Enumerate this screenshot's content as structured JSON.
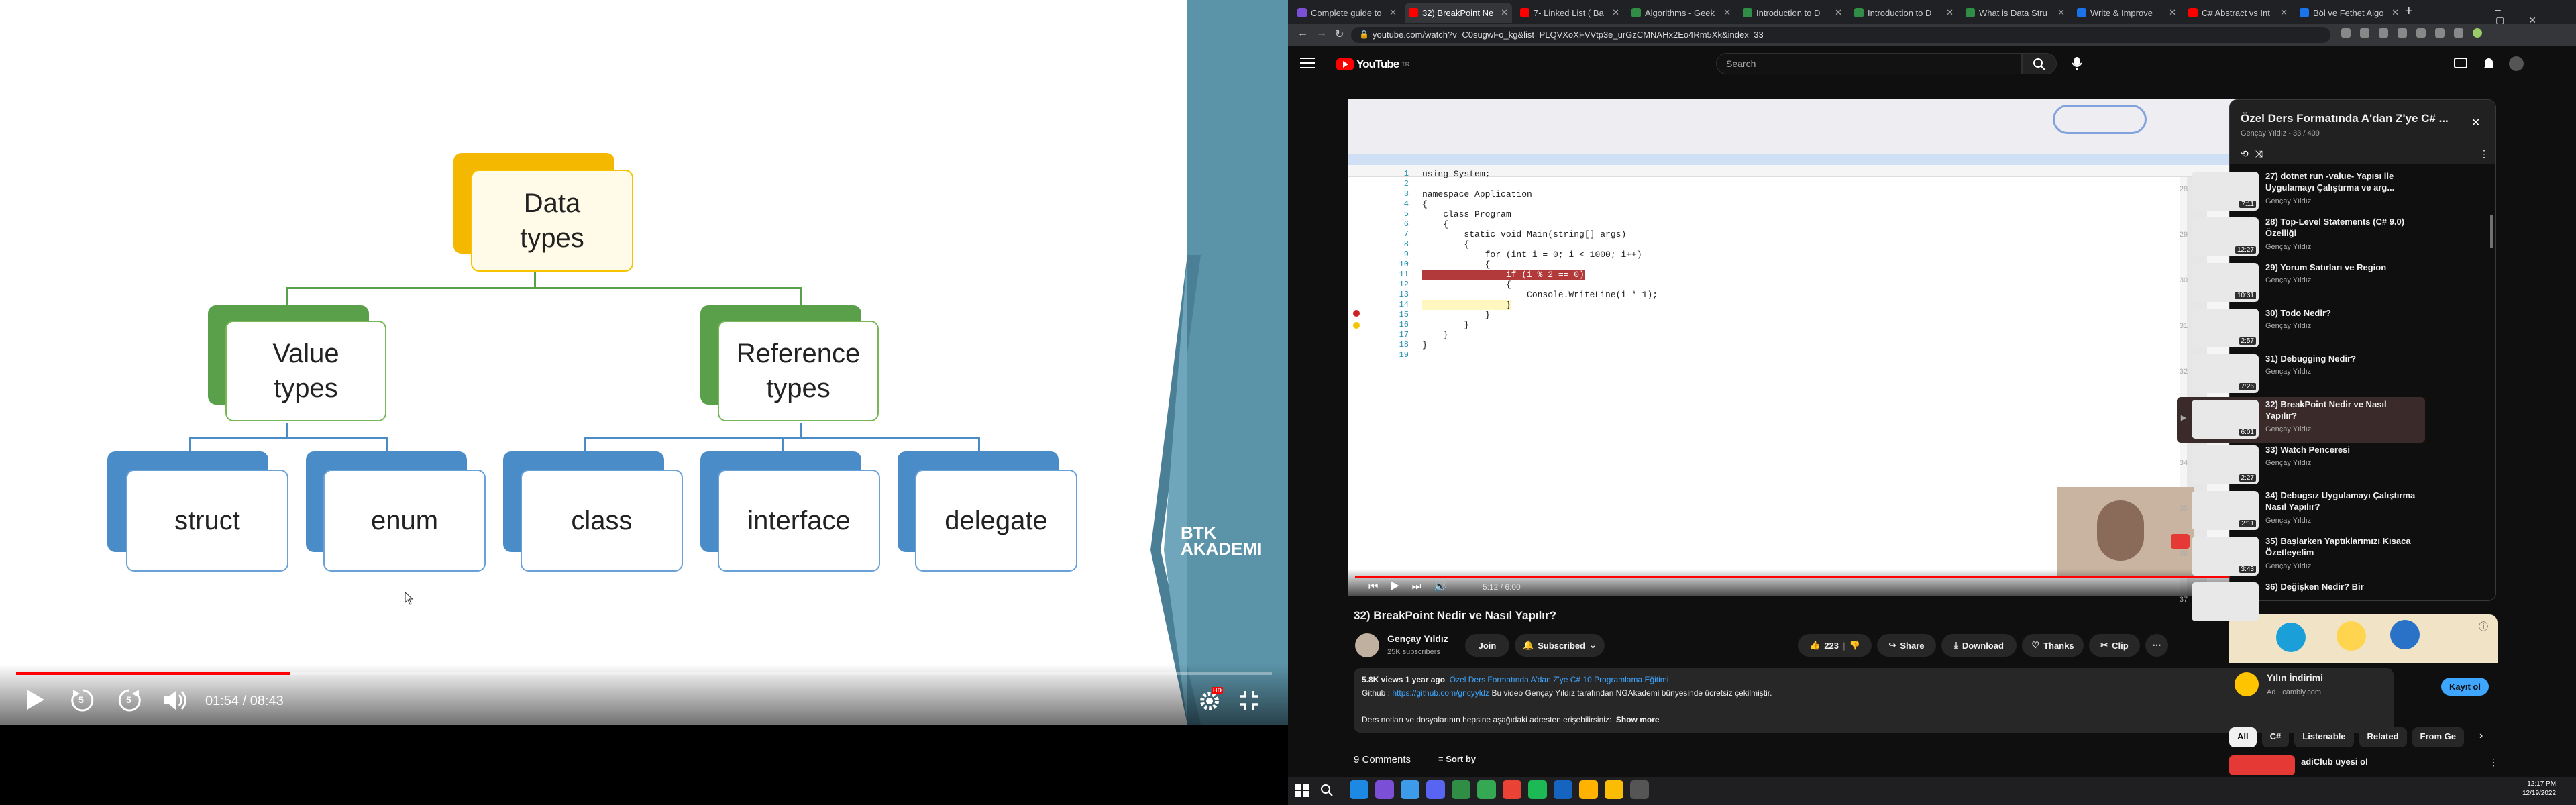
{
  "slide": {
    "root": "Data types",
    "value_types": "Value types",
    "reference_types": "Reference types",
    "leaves": [
      "struct",
      "enum",
      "class",
      "interface",
      "delegate"
    ],
    "logo_text": "BTK AKADEMI"
  },
  "left_player": {
    "time": "01:54 / 08:43",
    "progress": 0.218,
    "settings_badge": "HD",
    "skip_back": "5",
    "skip_fwd": "5"
  },
  "browser": {
    "tabs": [
      {
        "label": "Complete guide to",
        "color": "#7b4fd6"
      },
      {
        "label": "32) BreakPoint Ne",
        "color": "#ff0000"
      },
      {
        "label": "7- Linked List ( Ba",
        "color": "#ff0000"
      },
      {
        "label": "Algorithms - Geek",
        "color": "#2f8d46"
      },
      {
        "label": "Introduction to D",
        "color": "#2f8d46"
      },
      {
        "label": "Introduction to D",
        "color": "#2f8d46"
      },
      {
        "label": "What is Data Stru",
        "color": "#2f8d46"
      },
      {
        "label": "Write & Improve",
        "color": "#1a73e8"
      },
      {
        "label": "C# Abstract vs Int",
        "color": "#ff0000"
      },
      {
        "label": "Böl ve Fethet Algo",
        "color": "#1a73e8"
      }
    ],
    "url": "youtube.com/watch?v=C0sugwFo_kg&list=PLQVXoXFVVtp3e_urGzCMNAHx2Eo4Rm5Xk&index=33"
  },
  "youtube": {
    "search_placeholder": "Search",
    "logo": "YouTube",
    "country": "TR",
    "video_title": "32) BreakPoint Nedir ve Nasıl Yapılır?",
    "channel": "Gençay Yıldız",
    "subscribers": "25K subscribers",
    "join": "Join",
    "subscribed": "Subscribed",
    "likes": "223",
    "share": "Share",
    "download": "Download",
    "thanks": "Thanks",
    "clip": "Clip",
    "views_line": "5.8K views  1 year ago",
    "playlist_link": "Özel Ders Formatında A'dan Z'ye C# 10 Programlama Eğitimi",
    "desc1_label": "Github : ",
    "desc1_link": "https://github.com/gncyyldz",
    "desc1_rest": " Bu video Gençay Yıldız tarafından NGAkademi bünyesinde ücretsiz çekilmiştir.",
    "desc2": "Ders notları ve dosyalarının hepsine aşağıdaki adresten erişebilirsiniz:",
    "show_more": "Show more",
    "comments": "9 Comments",
    "sort_by": "Sort by",
    "inner_time": "5:12 / 6:00",
    "code_lines": [
      "using System;",
      "",
      "namespace Application",
      "{",
      "    class Program",
      "    {",
      "        static void Main(string[] args)",
      "        {",
      "            for (int i = 0; i < 1000; i++)",
      "            {",
      "                if (i % 2 == 0)",
      "                {",
      "                    Console.WriteLine(i * 1);",
      "                }",
      "            }",
      "        }",
      "    }",
      "}",
      ""
    ]
  },
  "playlist": {
    "title": "Özel Ders Formatında A'dan Z'ye C# ...",
    "subtitle": "Gençay Yıldız - 33 / 409",
    "items": [
      {
        "idx": "28",
        "title": "27) dotnet run -value- Yapısı ile Uygulamayı Çalıştırma ve arg...",
        "channel": "Gençay Yıldız",
        "duration": "7:11"
      },
      {
        "idx": "29",
        "title": "28) Top-Level Statements (C# 9.0) Özelliği",
        "channel": "Gençay Yıldız",
        "duration": "12:27"
      },
      {
        "idx": "30",
        "title": "29) Yorum Satırları ve Region",
        "channel": "Gençay Yıldız",
        "duration": "10:31"
      },
      {
        "idx": "31",
        "title": "30) Todo Nedir?",
        "channel": "Gençay Yıldız",
        "duration": "2:57"
      },
      {
        "idx": "32",
        "title": "31) Debugging Nedir?",
        "channel": "Gençay Yıldız",
        "duration": "7:26"
      },
      {
        "idx": "▶",
        "title": "32) BreakPoint Nedir ve Nasıl Yapılır?",
        "channel": "Gençay Yıldız",
        "duration": "6:01"
      },
      {
        "idx": "34",
        "title": "33) Watch Penceresi",
        "channel": "Gençay Yıldız",
        "duration": "2:27"
      },
      {
        "idx": "35",
        "title": "34) Debugsız Uygulamayı Çalıştırma Nasıl Yapılır?",
        "channel": "Gençay Yıldız",
        "duration": "2:11"
      },
      {
        "idx": "36",
        "title": "35) Başlarken Yaptıklarımızı Kısaca Özetleyelim",
        "channel": "Gençay Yıldız",
        "duration": "3:43"
      },
      {
        "idx": "37",
        "title": "36) Değişken Nedir? Bir",
        "channel": "",
        "duration": ""
      }
    ]
  },
  "ad": {
    "title": "Yılın İndirimi",
    "sponsor": "Ad · cambly.com",
    "cta": "Kayıt ol"
  },
  "chips": [
    "All",
    "C#",
    "Listenable",
    "Related",
    "From Ge"
  ],
  "next_video": {
    "title": "adiClub üyesi ol"
  },
  "taskbar": {
    "time": "12:17 PM",
    "date": "12/19/2022"
  }
}
